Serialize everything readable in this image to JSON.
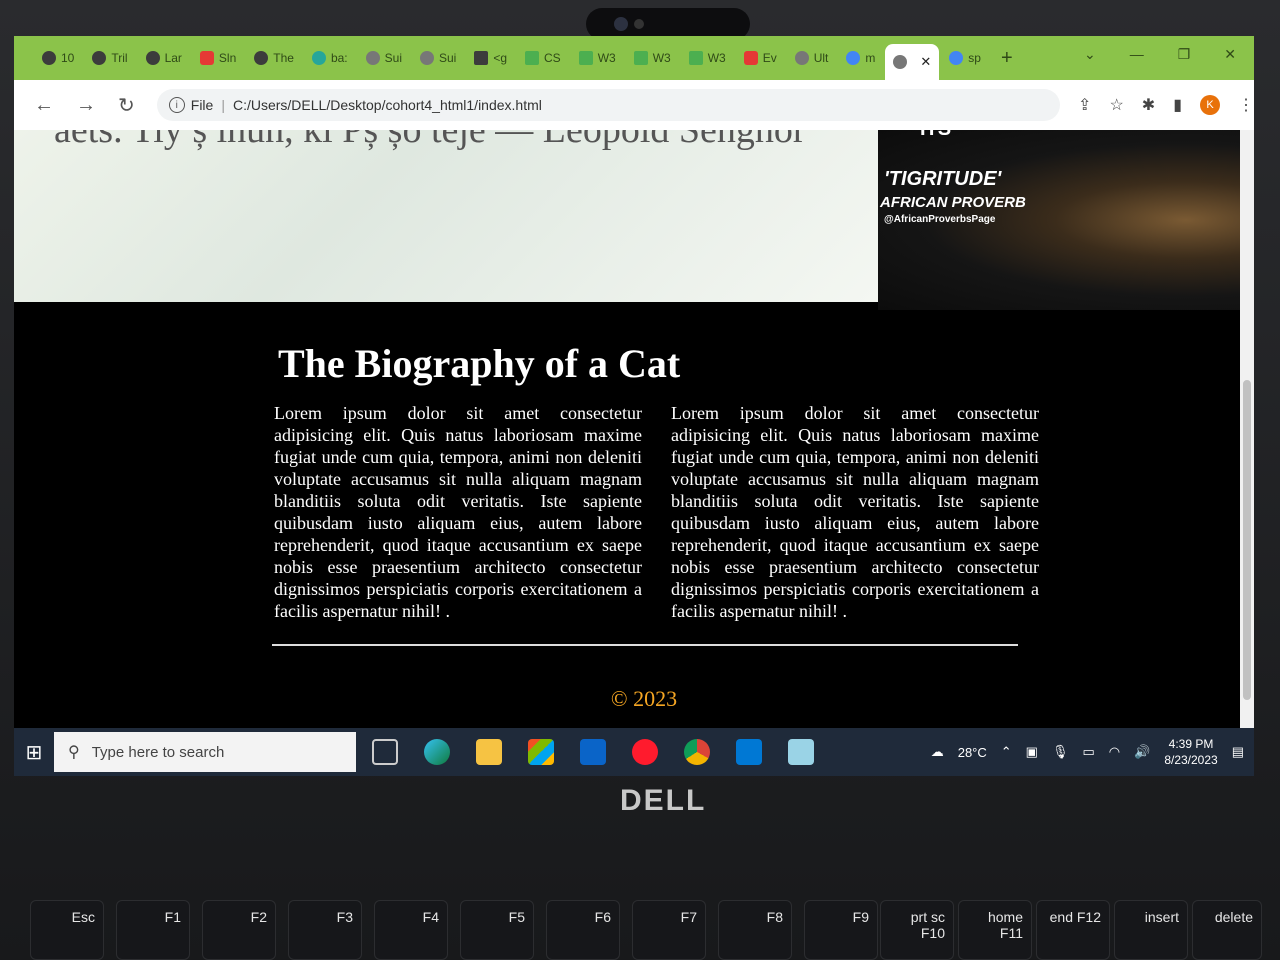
{
  "tabs": [
    {
      "label": "10",
      "icon": "tab-icon"
    },
    {
      "label": "Tril",
      "icon": "codepen-icon"
    },
    {
      "label": "Lar",
      "icon": "codepen-icon"
    },
    {
      "label": "Sln",
      "icon": "youtube-icon"
    },
    {
      "label": "The",
      "icon": "at-icon"
    },
    {
      "label": "ba:",
      "icon": "play-icon"
    },
    {
      "label": "Sui",
      "icon": "globe-icon"
    },
    {
      "label": "Sui",
      "icon": "globe-icon"
    },
    {
      "label": "<g",
      "icon": "m-icon"
    },
    {
      "label": "CS",
      "icon": "w3-icon"
    },
    {
      "label": "W3",
      "icon": "w3-icon"
    },
    {
      "label": "W3",
      "icon": "w3-icon"
    },
    {
      "label": "W3",
      "icon": "w3-icon"
    },
    {
      "label": "Ev",
      "icon": "youtube-icon"
    },
    {
      "label": "Ult",
      "icon": "globe-icon"
    },
    {
      "label": "m",
      "icon": "google-icon"
    },
    {
      "label": "",
      "icon": "globe-icon",
      "active": true
    },
    {
      "label": "sp",
      "icon": "google-icon"
    }
  ],
  "address": {
    "scheme_label": "File",
    "url": "C:/Users/DELL/Desktop/cohort4_html1/index.html"
  },
  "hero": {
    "quote_text": "aets. Tiy ș ihun, ki Pș șo teje — Leopold Senghor",
    "tiger_line1": "ITS",
    "tiger_line2": "'TIGRITUDE'",
    "tiger_line3": "AFRICAN PROVERB",
    "tiger_line4": "@AfricanProverbsPage"
  },
  "article": {
    "title": "The Biography of a Cat",
    "col1": "Lorem ipsum dolor sit amet consectetur adipisicing elit. Quis natus laboriosam maxime fugiat unde cum quia, tempora, animi non deleniti voluptate accusamus sit nulla aliquam magnam blanditiis soluta odit veritatis. Iste sapiente quibusdam iusto aliquam eius, autem labore reprehenderit, quod itaque accusantium ex saepe nobis esse praesentium architecto consectetur dignissimos perspiciatis corporis exercitationem a facilis aspernatur nihil! .",
    "col2": "Lorem ipsum dolor sit amet consectetur adipisicing elit. Quis natus laboriosam maxime fugiat unde cum quia, tempora, animi non deleniti voluptate accusamus sit nulla aliquam magnam blanditiis soluta odit veritatis. Iste sapiente quibusdam iusto aliquam eius, autem labore reprehenderit, quod itaque accusantium ex saepe nobis esse praesentium architecto consectetur dignissimos perspiciatis corporis exercitationem a facilis aspernatur nihil! .",
    "footer": "© 2023"
  },
  "taskbar": {
    "search_placeholder": "Type here to search",
    "weather": "28°C",
    "time": "4:39 PM",
    "date": "8/23/2023",
    "apps": [
      "task-view-icon",
      "edge-icon",
      "file-explorer-icon",
      "store-icon",
      "mail-icon",
      "opera-icon",
      "chrome-icon",
      "vscode-icon",
      "notepad-icon"
    ]
  },
  "device": {
    "brand": "DELL"
  },
  "keys": [
    {
      "label": "Esc"
    },
    {
      "label": "F1"
    },
    {
      "label": "F2"
    },
    {
      "label": "F3"
    },
    {
      "label": "F4"
    },
    {
      "label": "F5"
    },
    {
      "label": "F6"
    },
    {
      "label": "F7"
    },
    {
      "label": "F8"
    },
    {
      "label": "F9"
    },
    {
      "label": "prt sc F10"
    },
    {
      "label": "home F11"
    },
    {
      "label": "end F12"
    },
    {
      "label": "insert"
    },
    {
      "label": "delete"
    }
  ]
}
